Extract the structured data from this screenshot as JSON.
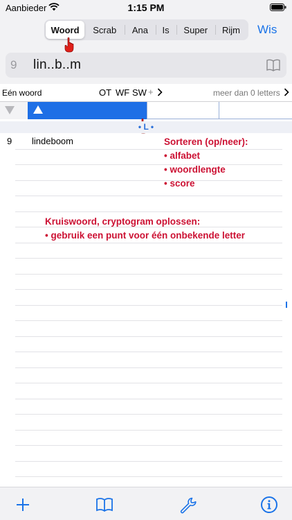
{
  "status_bar": {
    "carrier": "Aanbieder",
    "time": "1:15 PM"
  },
  "segments": {
    "woord": "Woord",
    "scrab": "Scrab",
    "ana": "Ana",
    "is": "Is",
    "super": "Super",
    "rijm": "Rijm",
    "selected": "Woord"
  },
  "wis_label": "Wis",
  "search": {
    "count": "9",
    "text": "lin..b..m"
  },
  "filter": {
    "left_label": "Eén woord",
    "ot": "OT",
    "wf": "WF",
    "sw": "SW",
    "plus": "+",
    "right_label": "meer dan 0 letters"
  },
  "sort_bar": {
    "active": "alfabet"
  },
  "letter_index": "• L •",
  "results": [
    {
      "length": "9",
      "word": "lindeboom"
    }
  ],
  "annotations": {
    "sort": {
      "title": "Sorteren (op/neer):",
      "items": [
        "• alfabet",
        "• woordlengte",
        "• score"
      ]
    },
    "crossword": {
      "title": "Kruiswoord, cryptogram oplossen:",
      "items": [
        "• gebruik een punt voor één onbekende letter"
      ]
    }
  },
  "colors": {
    "accent": "#1e6fe6",
    "annotation": "#cc1133"
  },
  "icons": {
    "toolbar": [
      "plus-icon",
      "book-icon",
      "wrench-icon",
      "info-icon"
    ],
    "pointer": "pointing-hand-icon"
  }
}
